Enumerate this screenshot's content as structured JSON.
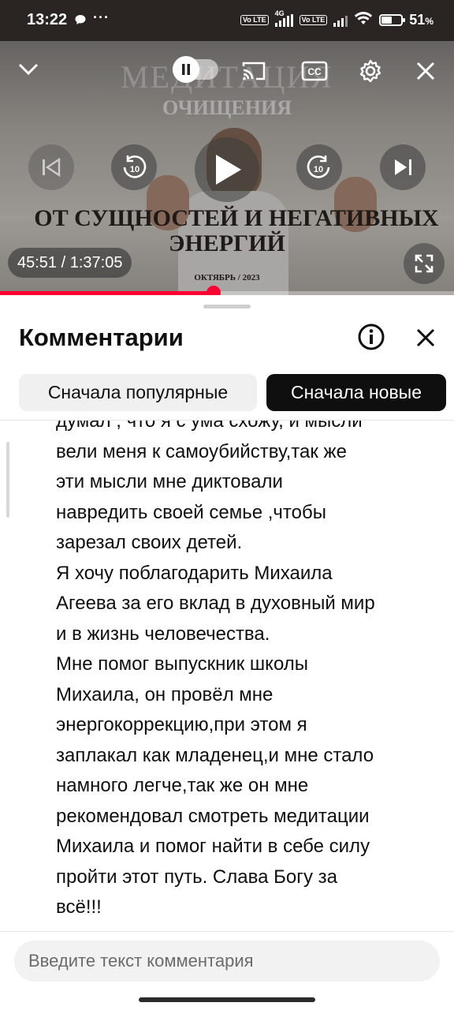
{
  "status_bar": {
    "time": "13:22",
    "dots": "···",
    "lte1": "Vo LTE",
    "net": "4G",
    "lte2": "Vo LTE",
    "battery_level": 51,
    "battery_text": "51"
  },
  "video": {
    "title_top": "МЕДИТАЦИЯ",
    "title_sub": "ОЧИЩЕНИЯ",
    "line1": "ОТ СУЩНОСТЕЙ  И НЕГАТИВНЫХ",
    "line2": "ЭНЕРГИЙ",
    "date": "ОКТЯБРЬ / 2023",
    "timecode": "45:51 / 1:37:05",
    "progress_fraction": 0.47,
    "accent_color": "#ff0033"
  },
  "icons": {
    "collapse": "chevron-down-icon",
    "pause": "pause-icon",
    "cast": "cast-icon",
    "captions": "cc-icon",
    "settings": "gear-icon",
    "close": "close-icon",
    "prev": "skip-previous-icon",
    "rewind": "rewind-10-icon",
    "play": "play-icon",
    "forward": "forward-10-icon",
    "next": "skip-next-icon",
    "fullscreen": "fullscreen-icon",
    "info": "info-icon"
  },
  "sheet": {
    "title": "Комментарии",
    "chips": {
      "popular": "Сначала популярные",
      "new": "Сначала новые"
    },
    "comment_lines": [
      "думал , что я с ума схожу, и мысли",
      "вели меня к самоубийству,так же",
      "эти мысли мне диктовали",
      "навредить своей семье ,чтобы",
      "зарезал своих детей.",
      "Я хочу поблагодарить Михаила",
      "Агеева за его вклад в духовный мир",
      "и в жизнь человечества.",
      "Мне помог выпускник школы",
      "Михаила, он провёл мне",
      "энергокоррекцию,при этом я",
      "заплакал как младенец,и мне стало",
      "намного легче,так же он мне",
      "рекомендовал  смотреть медитации",
      "Михаила и помог найти в себе силу",
      "пройти этот путь. Слава Богу за",
      "всё!!!"
    ],
    "compose_placeholder": "Введите текст комментария"
  }
}
